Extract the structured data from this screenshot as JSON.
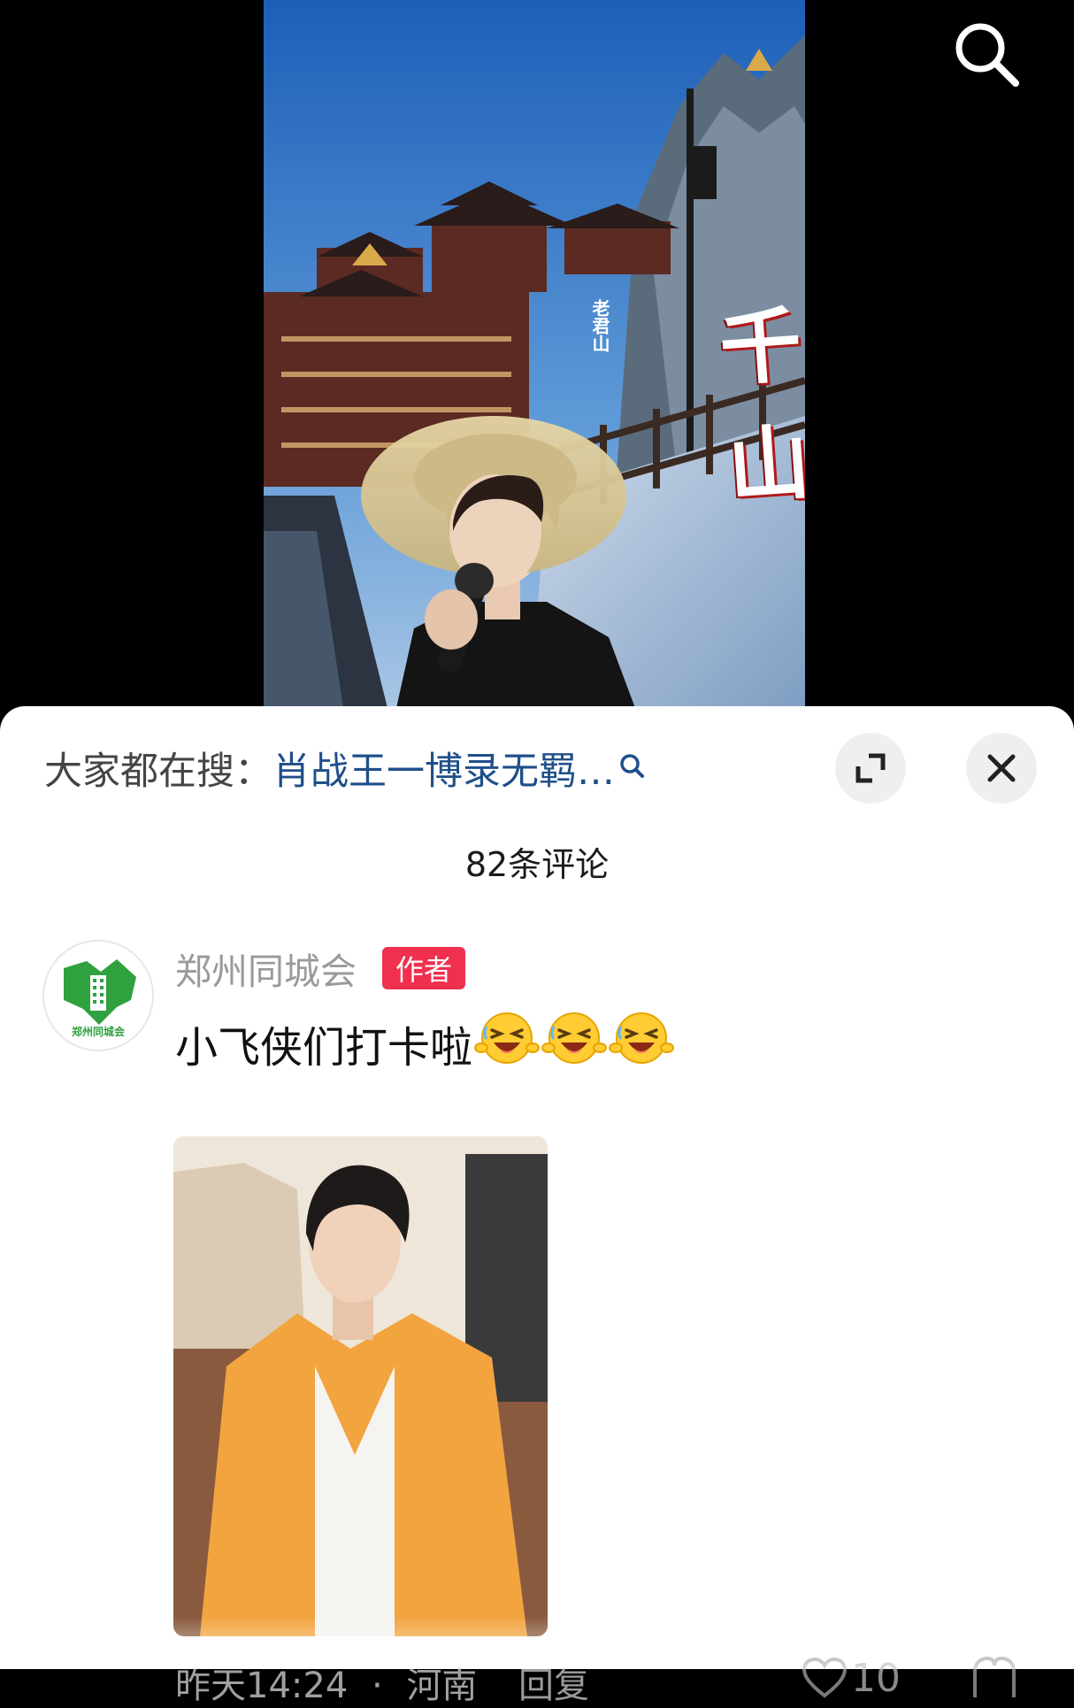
{
  "video": {
    "overlay_label": "老君山",
    "overlay_title": "千山"
  },
  "icons": {
    "top_search": "search-icon",
    "keyword_search": "search-icon",
    "expand": "expand-icon",
    "close": "close-icon",
    "like": "heart-icon",
    "dislike": "dislike-icon",
    "emoji": "laughing-emoji"
  },
  "trending": {
    "label": "大家都在搜：",
    "keyword": "肖战王一博录无羁…"
  },
  "comments_header": {
    "count_text": "82条评论"
  },
  "comment": {
    "author": "郑州同城会",
    "badge": "作者",
    "text": "小飞侠们打卡啦",
    "emoji_count": 3,
    "timestamp": "昨天14:24",
    "separator": "·",
    "location": "河南",
    "reply_label": "回复",
    "like_count": "10",
    "avatar_text": "郑州同城会"
  },
  "colors": {
    "keyword": "#1f4f8a",
    "badge": "#f0304f",
    "sheet": "#ffffff",
    "background": "#000000"
  }
}
